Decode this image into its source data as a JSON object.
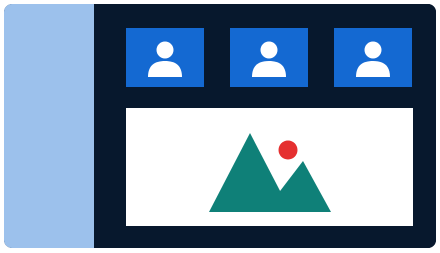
{
  "colors": {
    "sidebar": "#9cc1ec",
    "window_background": "#07182d",
    "participant_tile": "#1469d2",
    "participant_glyph": "#ffffff",
    "stage_background": "#ffffff",
    "mountain": "#0f8078",
    "sun": "#e53030"
  },
  "sidebar": {
    "icon": "sidebar-panel"
  },
  "participants": [
    {
      "icon": "user-icon"
    },
    {
      "icon": "user-icon"
    },
    {
      "icon": "user-icon"
    }
  ],
  "stage": {
    "icon": "image-placeholder-icon"
  }
}
